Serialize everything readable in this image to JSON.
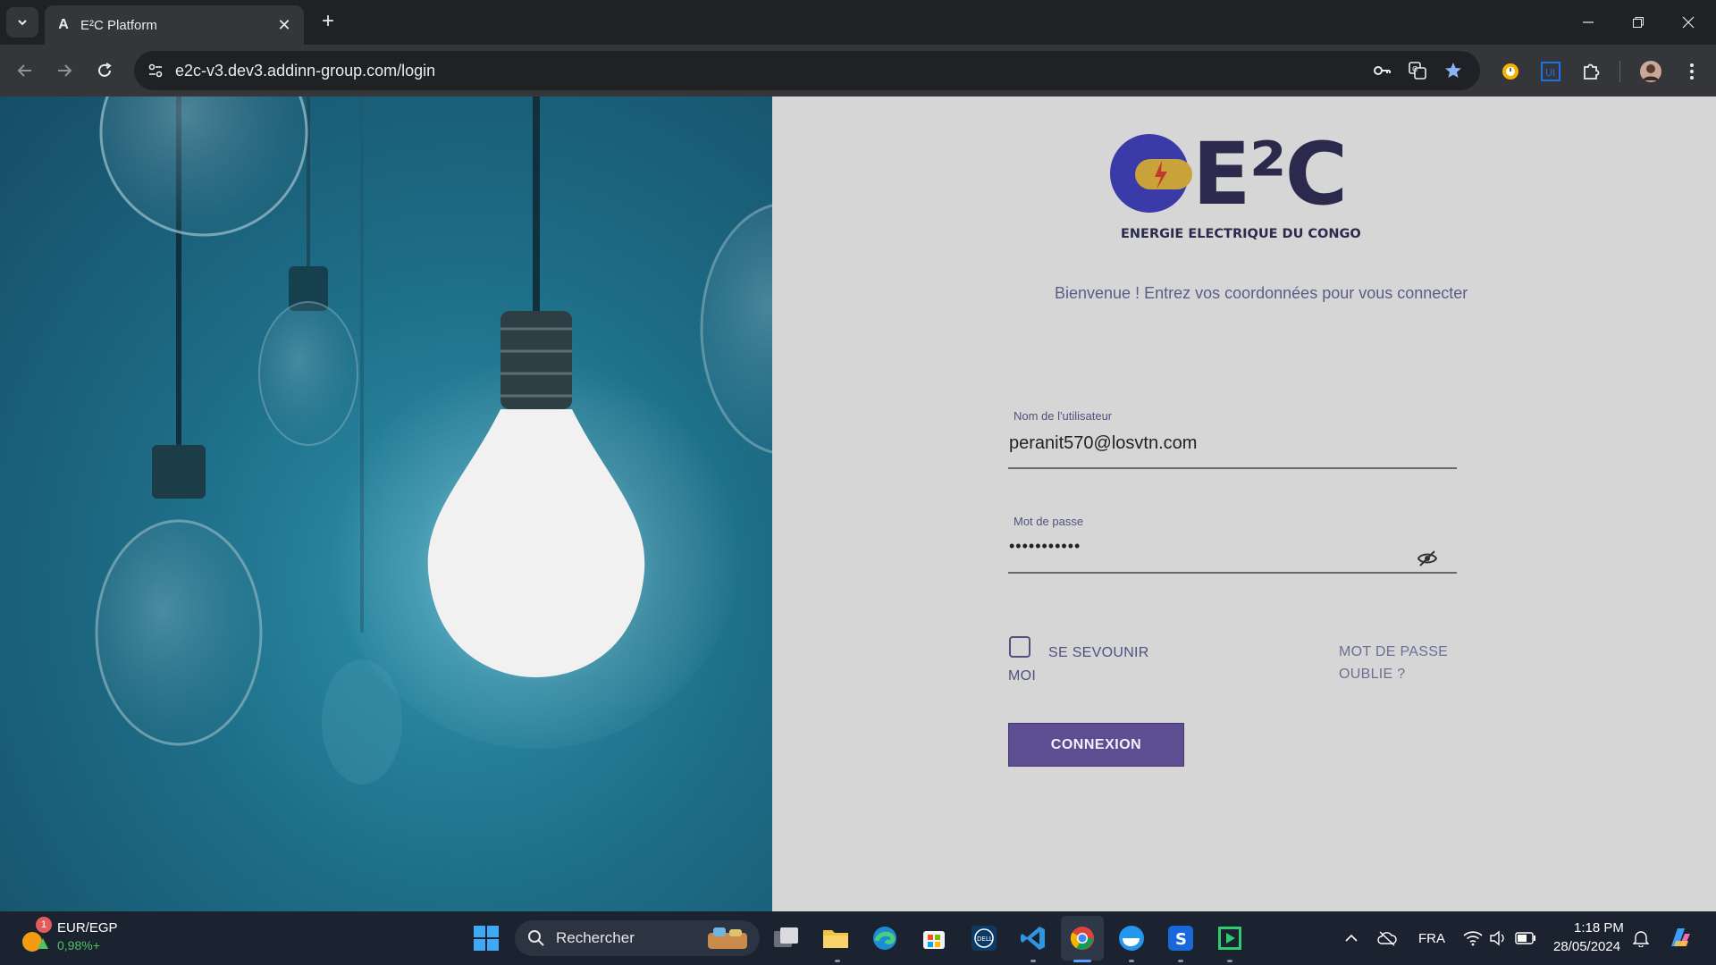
{
  "browser": {
    "tab_title": "E²C Platform",
    "url": "e2c-v3.dev3.addinn-group.com/login",
    "new_tab_symbol": "+",
    "close_symbol": "✕"
  },
  "logo": {
    "wordmark": "E²C",
    "tagline": "ENERGIE ELECTRIQUE DU CONGO"
  },
  "login": {
    "welcome": "Bienvenue ! Entrez vos coordonnées pour vous connecter",
    "username_label": "Nom de l'utilisateur",
    "username_value": "peranit570@losvtn.com",
    "password_label": "Mot de passe",
    "password_value": "•••••••••••",
    "remember_line1": "SE SEVOUNIR",
    "remember_line2": "MOI",
    "forgot_line1": "MOT DE PASSE",
    "forgot_line2": "OUBLIE ?",
    "submit": "CONNEXION"
  },
  "taskbar": {
    "weather_badge": "1",
    "ticker": "EUR/EGP",
    "ticker_change": "0,98%+",
    "search_label": "Rechercher",
    "language": "FRA",
    "time": "1:18 PM",
    "date": "28/05/2024"
  },
  "colors": {
    "accent": "#5d4e92",
    "logo_dark": "#2b2a4c",
    "logo_blue": "#3a3aa8",
    "logo_gold": "#c9a23a"
  }
}
